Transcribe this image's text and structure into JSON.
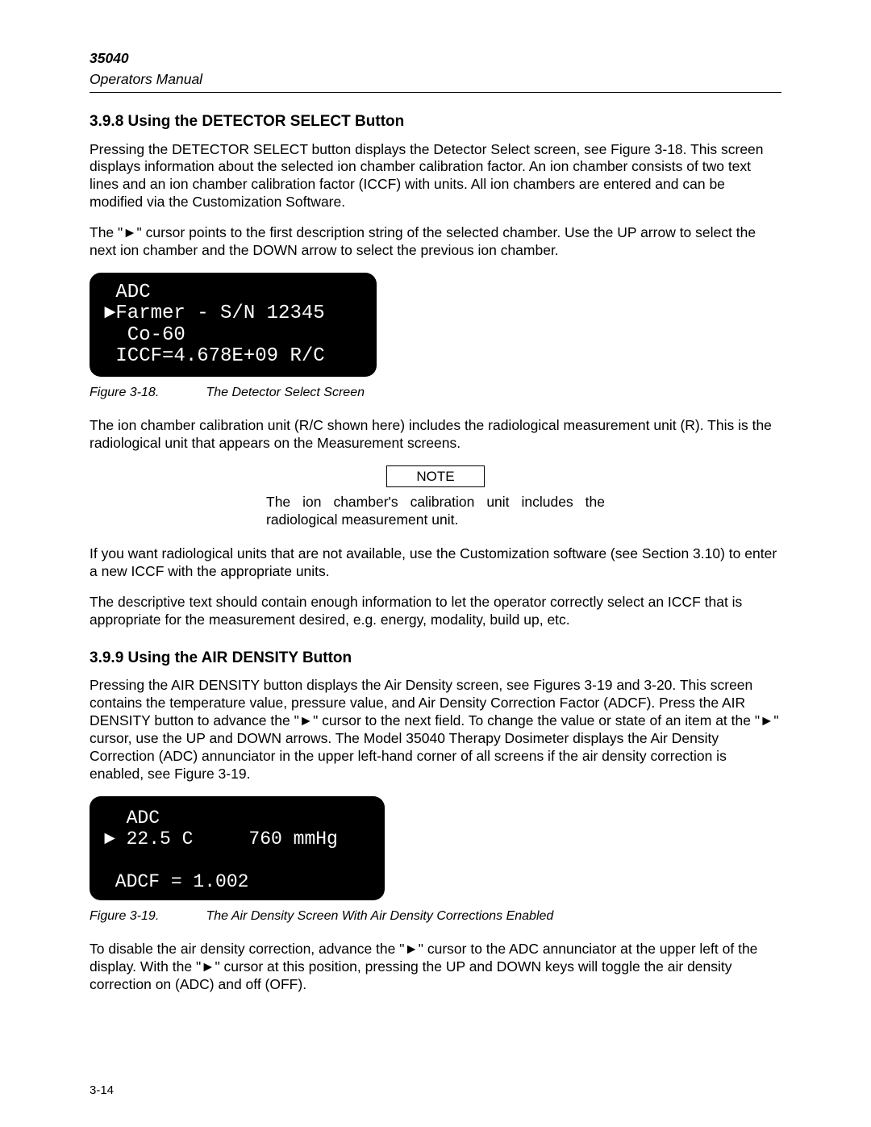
{
  "header": {
    "model": "35040",
    "subtitle": "Operators Manual"
  },
  "section1": {
    "heading": "3.9.8 Using the DETECTOR SELECT Button",
    "para1": "Pressing the DETECTOR SELECT button displays the Detector Select screen, see Figure 3-18.  This screen displays information about the selected ion chamber calibration factor.  An ion chamber consists of two text lines and an ion chamber calibration factor (ICCF) with units.  All ion chambers are entered and can be modified via the Customization Software.",
    "para2": "The \"►\" cursor points to the first description string of the selected chamber.   Use the UP arrow to select the next ion chamber and the DOWN arrow to select the previous ion chamber.",
    "screen": {
      "l1": " ADC",
      "l2": "►Farmer - S/N 12345",
      "l3": "  Co-60",
      "l4": " ICCF=4.678E+09 R/C"
    },
    "fig18": {
      "label": "Figure 3-18.",
      "title": "The Detector Select Screen"
    },
    "para3": "The ion chamber calibration unit (R/C shown here) includes the radiological measurement unit (R).  This is the radiological unit that appears on the Measurement screens.",
    "note": {
      "label": "NOTE",
      "text": "The ion chamber's calibration unit includes the radiological measurement unit."
    },
    "para4": "If you want radiological units that are not available, use the Customization software (see Section 3.10) to enter a new ICCF with the appropriate units.",
    "para5": "The descriptive text should contain enough information to let the operator correctly select an ICCF that is appropriate for the measurement desired, e.g. energy, modality, build up, etc."
  },
  "section2": {
    "heading": "3.9.9 Using the AIR DENSITY Button",
    "para1": "Pressing the AIR DENSITY button displays the Air Density screen, see Figures 3-19 and 3-20.  This screen contains the temperature value, pressure value, and Air Density Correction Factor (ADCF).  Press the AIR DENSITY button to advance the \"►\" cursor to the next field.  To change the value or state of an item at the \"►\" cursor, use the UP and DOWN arrows.  The Model 35040 Therapy Dosimeter displays the Air Density Correction (ADC) annunciator in the upper left-hand corner of all screens if the air density correction is enabled, see Figure 3-19.",
    "screen": {
      "l1": "  ADC",
      "l2": "► 22.5 C     760 mmHg",
      "l3": " ",
      "l4": " ADCF = 1.002"
    },
    "fig19": {
      "label": "Figure 3-19.",
      "title": "The Air Density Screen With Air Density Corrections Enabled"
    },
    "para2": "To disable the air density correction, advance the \"►\" cursor to the ADC annunciator at the upper left of the display.  With the \"►\" cursor at this position, pressing the UP and DOWN keys will toggle the air density correction on (ADC) and off (OFF)."
  },
  "footer": {
    "pagenum": "3-14"
  }
}
